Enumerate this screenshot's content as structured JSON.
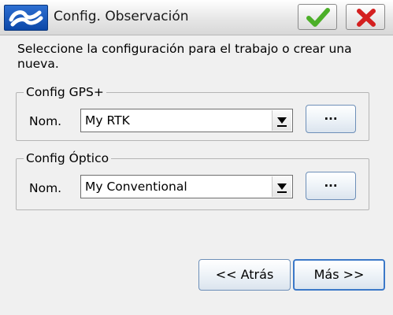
{
  "titlebar": {
    "title": "Config. Observación",
    "logo_icon": "trimble-logo-icon",
    "ok_icon": "check-icon",
    "close_icon": "close-icon"
  },
  "instruction": "Seleccione la configuración para el trabajo o crear una nueva.",
  "gps_group": {
    "legend": "Config GPS+",
    "field_label": "Nom.",
    "selected_value": "My RTK",
    "browse_label": "..."
  },
  "optical_group": {
    "legend": "Config Óptico",
    "field_label": "Nom.",
    "selected_value": "My Conventional",
    "browse_label": "..."
  },
  "buttons": {
    "back_label": "<< Atrás",
    "next_label": "Más >>"
  },
  "colors": {
    "ok_check": "#4caf28",
    "close_x": "#d42020",
    "logo_blue": "#0b47a8"
  }
}
